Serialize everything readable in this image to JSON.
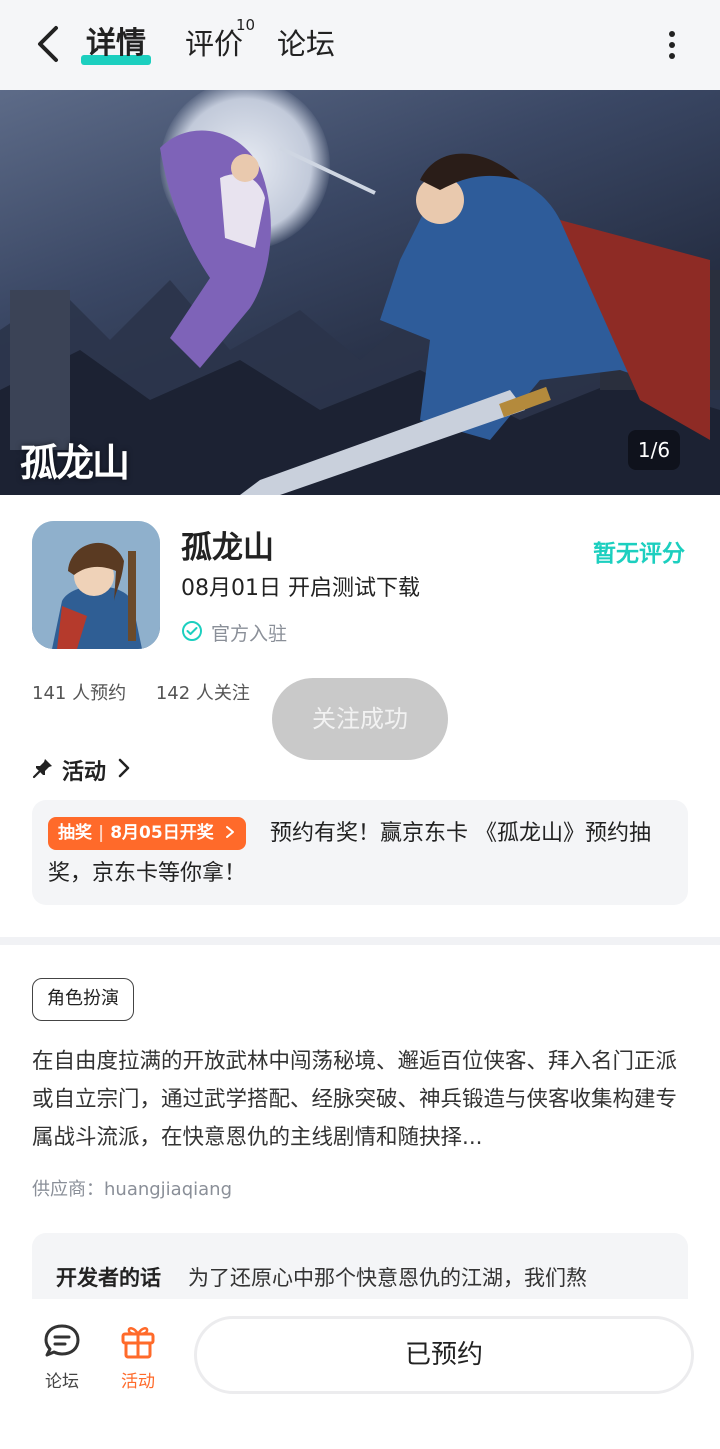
{
  "nav": {
    "tabs": [
      {
        "label": "详情"
      },
      {
        "label": "评价",
        "count": "10"
      },
      {
        "label": "论坛"
      }
    ]
  },
  "banner": {
    "logo_text": "孤龙山",
    "counter": "1/6"
  },
  "app": {
    "name": "孤龙山",
    "subtitle": "08月01日 开启测试下载",
    "official_label": "官方入驻",
    "rating_text": "暂无评分",
    "reservations": "141 人预约",
    "followers": "142 人关注"
  },
  "toast": {
    "text": "关注成功"
  },
  "activity": {
    "section_label": "活动",
    "tag_type": "抽奖",
    "tag_date": "8月05日开奖",
    "text": "预约有奖！赢京东卡 《孤龙山》预约抽奖，京东卡等你拿！"
  },
  "details": {
    "genre_tag": "角色扮演",
    "description": "在自由度拉满的开放武林中闯荡秘境、邂逅百位侠客、拜入名门正派或自立宗门，通过武学搭配、经脉突破、神兵锻造与侠客收集构建专属战斗流派，在快意恩仇的主线剧情和随抉择...",
    "supplier": "供应商：huangjiaqiang",
    "developer_title": "开发者的话",
    "developer_text": "为了还原心中那个快意恩仇的江湖，我们熬"
  },
  "bottom_bar": {
    "forum_label": "论坛",
    "activity_label": "活动",
    "reserve_label": "已预约"
  },
  "colors": {
    "accent": "#1ccfbf",
    "orange": "#ff6a2a",
    "toast_bg": "#c9c9c9"
  }
}
